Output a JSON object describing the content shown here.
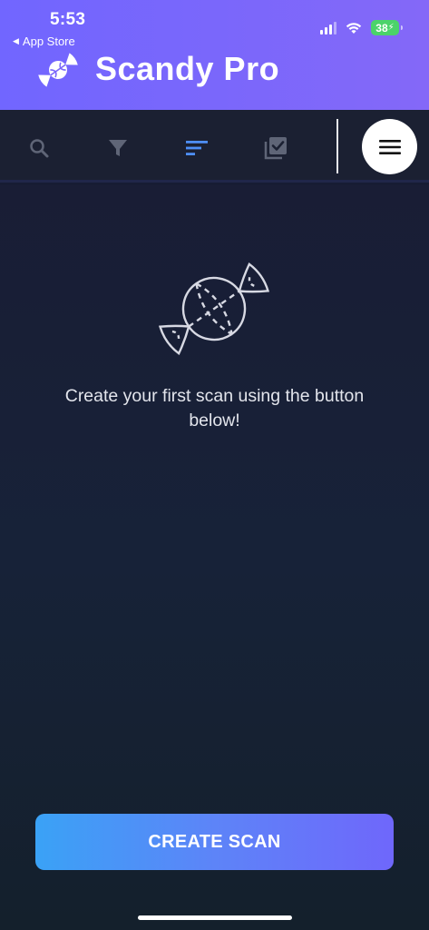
{
  "status_bar": {
    "time": "5:53",
    "back_label": "App Store",
    "battery": "38"
  },
  "header": {
    "title": "Scandy Pro",
    "logo_icon": "candy-icon"
  },
  "toolbar": {
    "tools": [
      {
        "name": "search-icon",
        "active": false
      },
      {
        "name": "filter-icon",
        "active": false
      },
      {
        "name": "sort-icon",
        "active": true
      },
      {
        "name": "select-multiple-icon",
        "active": false
      }
    ],
    "menu_icon": "hamburger-menu-icon"
  },
  "empty_state": {
    "icon": "candy-outline-icon",
    "message": "Create your first scan using the button below!"
  },
  "actions": {
    "create_label": "CREATE SCAN"
  },
  "colors": {
    "header_start": "#7166ff",
    "header_end": "#8468f8",
    "background": "#171c33",
    "accent_active": "#4e8ff7",
    "icon_inactive": "#5f6577",
    "button_start": "#3aa2f6",
    "button_end": "#6f67fb"
  }
}
